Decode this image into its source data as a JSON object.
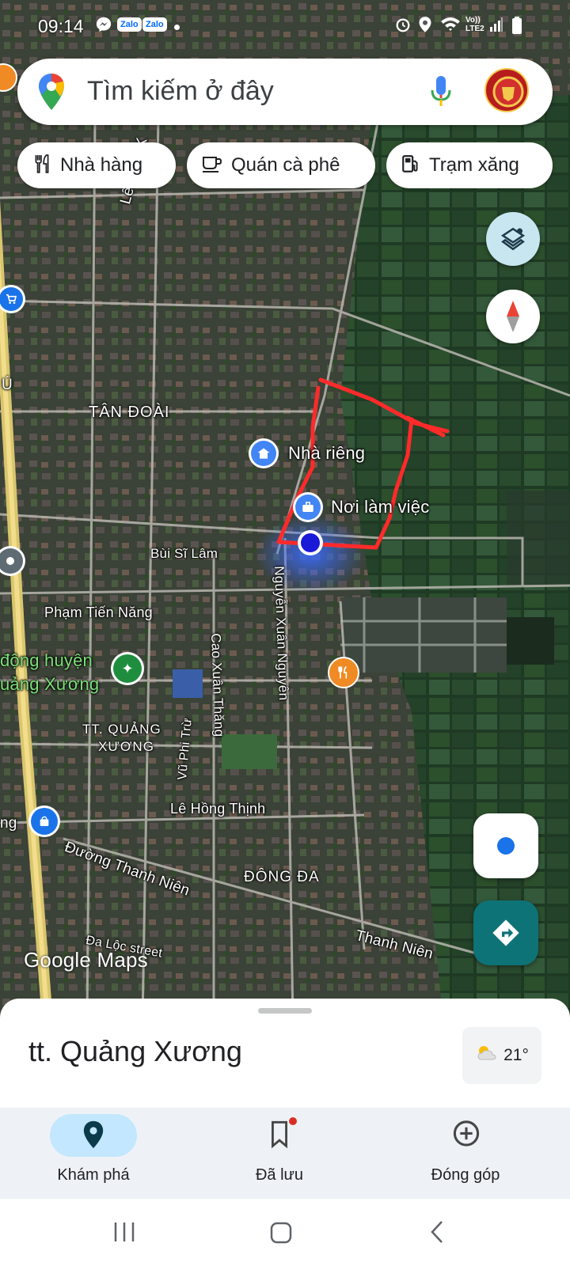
{
  "status_bar": {
    "time": "09:14",
    "left_icons": [
      "messenger-icon",
      "zalo-icon",
      "zalo-icon",
      "dot-icon"
    ],
    "zalo_label": "Zalo",
    "right_icons": [
      "alarm-icon",
      "location-icon",
      "wifi-icon",
      "volte-icon",
      "signal-icon",
      "battery-icon"
    ],
    "volte_label": "Vo)) LTE2"
  },
  "search": {
    "placeholder": "Tìm kiếm ở đây"
  },
  "chips": [
    {
      "label": "Nhà hàng",
      "icon": "restaurant-icon"
    },
    {
      "label": "Quán cà phê",
      "icon": "coffee-icon"
    },
    {
      "label": "Trạm xăng",
      "icon": "gas-station-icon"
    }
  ],
  "map": {
    "labels": {
      "le_dinh": "Lê Đình K",
      "tan_doai": "TÂN ĐOÀI",
      "u": "Ú",
      "bui_si_lam": "Bùi Sĩ Lâm",
      "pham_tien_nang": "Phạm Tiến Năng",
      "nguyen_xuan_nguyen": "Nguyễn Xuân Nguyên",
      "cao_xuan_thang": "Cao Xuân Thăng",
      "dong_huyen": "động huyện",
      "quang_xuong_green": "uảng Xương",
      "tt_quang_xuong_1": "TT. QUẢNG",
      "tt_quang_xuong_2": "XƯƠNG",
      "vu_phi_tru": "Vũ Phi Trừ",
      "le_hong_thinh": "Lê Hồng Thịnh",
      "ng": "ng",
      "duong_thanh_nien": "Đường Thanh Niên",
      "dong_da": "ĐÔNG ĐA",
      "thanh_nien": "Thanh Niên",
      "da_loc_street": "Đa Lộc street",
      "attribution": "Google Maps"
    },
    "places": {
      "home": "Nhà riêng",
      "work": "Nơi làm việc"
    },
    "annotation_color": "#ff2222"
  },
  "sheet": {
    "place_name": "tt. Quảng Xương",
    "weather": {
      "temp": "21°",
      "icon": "partly-cloudy-icon"
    }
  },
  "nav": [
    {
      "label": "Khám phá",
      "icon": "location-pin-icon",
      "active": true
    },
    {
      "label": "Đã lưu",
      "icon": "bookmark-icon",
      "active": false,
      "badge": true
    },
    {
      "label": "Đóng góp",
      "icon": "add-circle-icon",
      "active": false
    }
  ],
  "system_nav": [
    "recents-icon",
    "home-icon",
    "back-icon"
  ],
  "colors": {
    "accent_teal": "#0d7377",
    "active_pill": "#c2e7ff",
    "location_blue": "#1a73e8",
    "restaurant_orange": "#f08a24",
    "nav_bg": "#eef2f6"
  }
}
